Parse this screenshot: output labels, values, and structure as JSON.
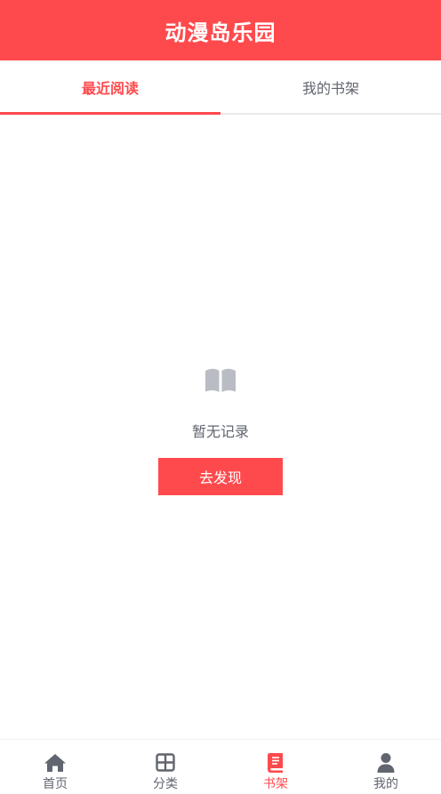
{
  "header": {
    "title": "动漫岛乐园"
  },
  "tabs": [
    {
      "label": "最近阅读",
      "active": true
    },
    {
      "label": "我的书架",
      "active": false
    }
  ],
  "empty_state": {
    "icon": "open-book-icon",
    "message": "暂无记录",
    "button_label": "去发现"
  },
  "bottom_nav": [
    {
      "label": "首页",
      "icon": "home-icon",
      "active": false
    },
    {
      "label": "分类",
      "icon": "grid-icon",
      "active": false
    },
    {
      "label": "书架",
      "icon": "book-icon",
      "active": true
    },
    {
      "label": "我的",
      "icon": "user-icon",
      "active": false
    }
  ],
  "colors": {
    "accent": "#ff4a4d",
    "text_secondary": "#61656f",
    "icon_muted": "#b9bcc3"
  }
}
